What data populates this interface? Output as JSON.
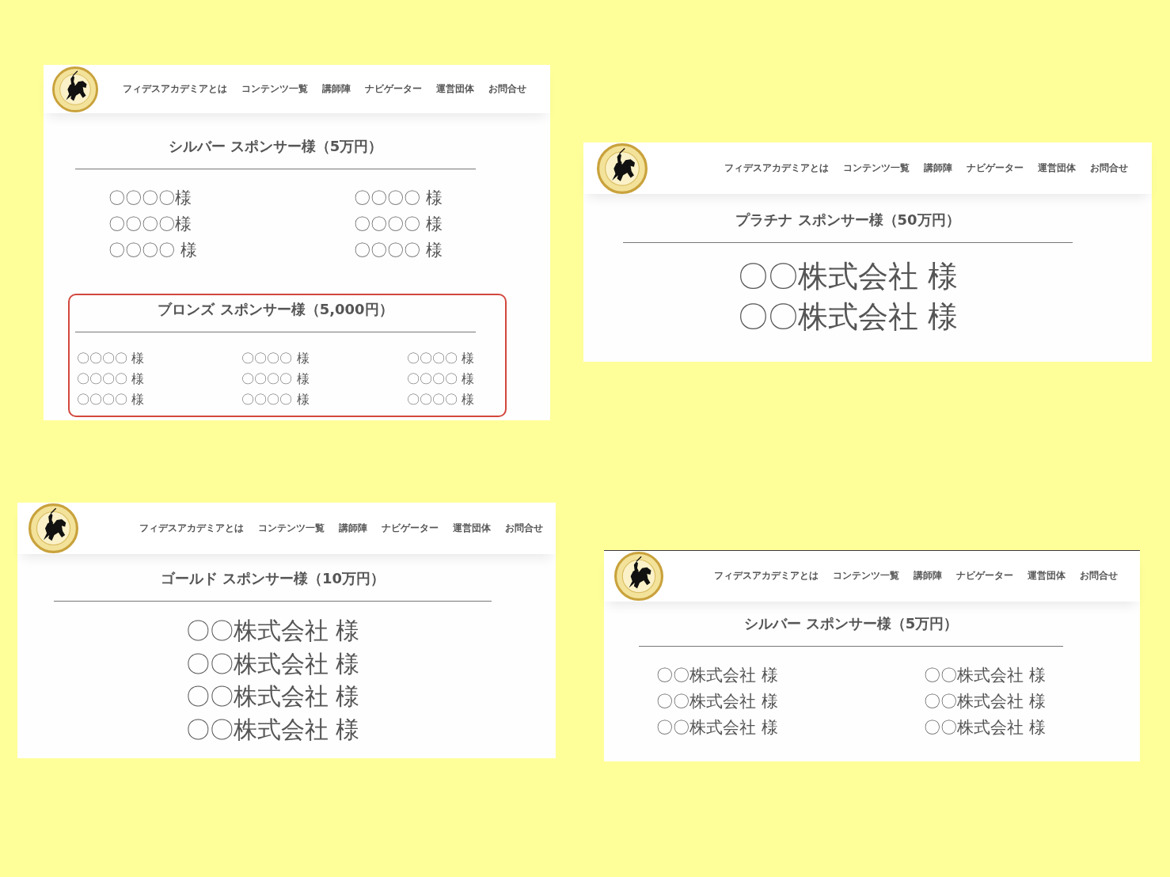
{
  "panels": [
    {
      "nav": [
        "フィデスアカデミアとは",
        "コンテンツ一覧",
        "講師陣",
        "ナビゲーター",
        "運営団体",
        "お問合せ"
      ],
      "sections": [
        {
          "title": "シルバー スポンサー様（5万円）",
          "kind": "silver",
          "highlighted": false,
          "columns": [
            [
              "〇〇〇〇様",
              "〇〇〇〇様",
              "〇〇〇〇 様"
            ],
            [
              "〇〇〇〇 様",
              "〇〇〇〇 様",
              "〇〇〇〇 様"
            ]
          ]
        },
        {
          "title": "ブロンズ スポンサー様（5,000円）",
          "kind": "bronze",
          "highlighted": true,
          "columns": [
            [
              "〇〇〇〇 様",
              "〇〇〇〇 様",
              "〇〇〇〇 様"
            ],
            [
              "〇〇〇〇 様",
              "〇〇〇〇 様",
              "〇〇〇〇 様"
            ],
            [
              "〇〇〇〇 様",
              "〇〇〇〇 様",
              "〇〇〇〇 様"
            ]
          ]
        }
      ]
    },
    {
      "nav": [
        "フィデスアカデミアとは",
        "コンテンツ一覧",
        "講師陣",
        "ナビゲーター",
        "運営団体",
        "お問合せ"
      ],
      "sections": [
        {
          "title": "プラチナ スポンサー様（50万円）",
          "kind": "platinum",
          "highlighted": false,
          "columns": [
            [
              "〇〇株式会社 様",
              "〇〇株式会社 様"
            ]
          ]
        }
      ]
    },
    {
      "nav": [
        "フィデスアカデミアとは",
        "コンテンツ一覧",
        "講師陣",
        "ナビゲーター",
        "運営団体",
        "お問合せ"
      ],
      "sections": [
        {
          "title": "ゴールド スポンサー様（10万円）",
          "kind": "gold",
          "highlighted": false,
          "columns": [
            [
              "〇〇株式会社 様",
              "〇〇株式会社 様",
              "〇〇株式会社 様",
              "〇〇株式会社 様"
            ]
          ]
        }
      ]
    },
    {
      "nav": [
        "フィデスアカデミアとは",
        "コンテンツ一覧",
        "講師陣",
        "ナビゲーター",
        "運営団体",
        "お問合せ"
      ],
      "sections": [
        {
          "title": "シルバー スポンサー様（5万円）",
          "kind": "silver",
          "highlighted": false,
          "columns": [
            [
              "〇〇株式会社 様",
              "〇〇株式会社 様",
              "〇〇株式会社 様"
            ],
            [
              "〇〇株式会社 様",
              "〇〇株式会社 様",
              "〇〇株式会社 様"
            ]
          ]
        }
      ]
    }
  ]
}
